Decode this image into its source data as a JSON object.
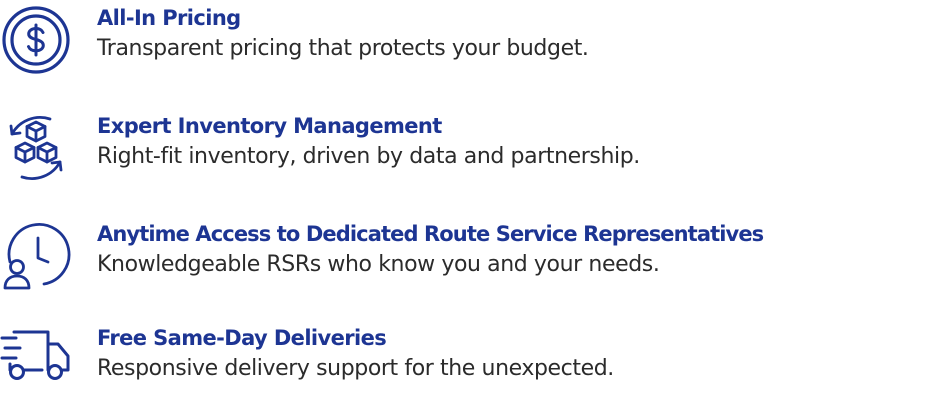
{
  "colors": {
    "accent": "#1d3593",
    "text": "#2b2b2b",
    "background": "#ffffff"
  },
  "features": [
    {
      "icon": "dollar-coin-icon",
      "title": "All-In Pricing",
      "description": "Transparent pricing that protects your budget."
    },
    {
      "icon": "inventory-boxes-cycle-icon",
      "title": "Expert Inventory Management",
      "description": "Right-fit inventory, driven by data and partnership."
    },
    {
      "icon": "clock-person-icon",
      "title": "Anytime Access to Dedicated Route Service Representatives",
      "description": "Knowledgeable RSRs who know you and your needs."
    },
    {
      "icon": "delivery-truck-icon",
      "title": "Free Same-Day Deliveries",
      "description": "Responsive delivery support for the unexpected."
    }
  ]
}
